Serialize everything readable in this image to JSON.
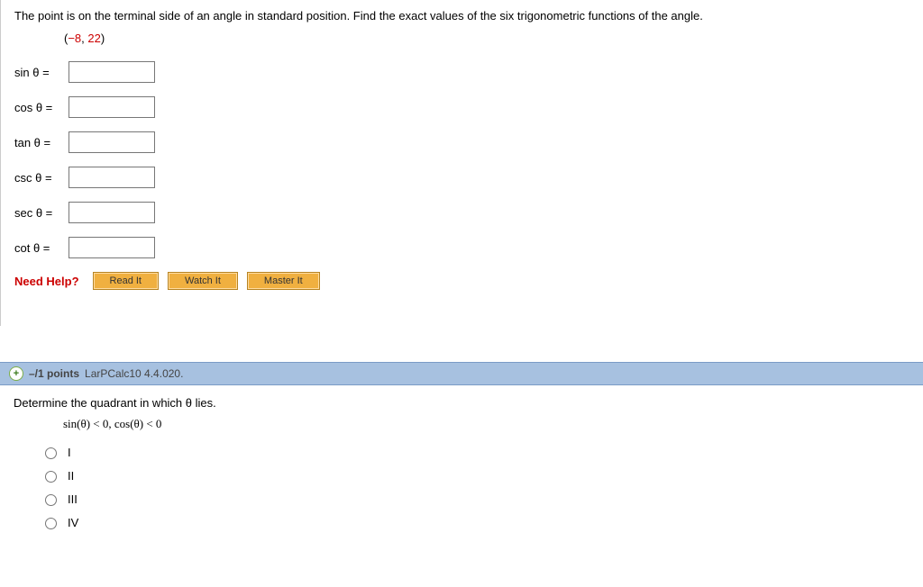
{
  "q1": {
    "prompt": "The point is on the terminal side of an angle in standard position. Find the exact values of the six trigonometric functions of the angle.",
    "point_open": "(",
    "point_x": "−8",
    "point_sep": ", ",
    "point_y": "22",
    "point_close": ")",
    "labels": {
      "sin": "sin θ =",
      "cos": "cos θ =",
      "tan": "tan θ =",
      "csc": "csc θ =",
      "sec": "sec θ =",
      "cot": "cot θ ="
    },
    "needhelp": "Need Help?",
    "buttons": {
      "read": "Read It",
      "watch": "Watch It",
      "master": "Master It"
    }
  },
  "q2": {
    "expand": "+",
    "points": "–/1 points",
    "ref": "LarPCalc10 4.4.020.",
    "prompt": "Determine the quadrant in which θ lies.",
    "cond": "sin(θ) < 0, cos(θ) < 0",
    "opts": {
      "a": "I",
      "b": "II",
      "c": "III",
      "d": "IV"
    }
  }
}
